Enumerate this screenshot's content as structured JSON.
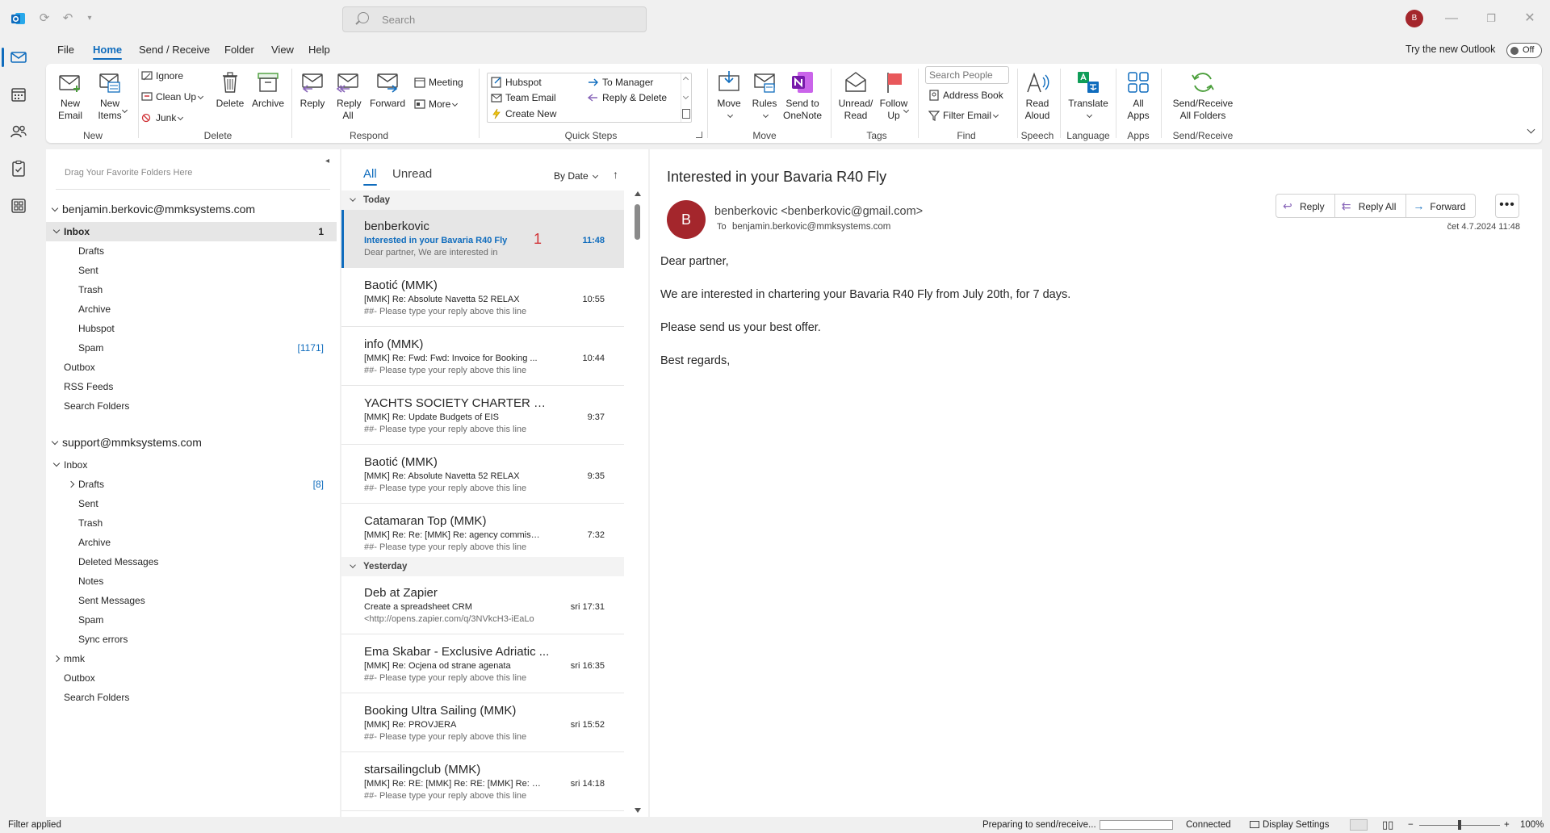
{
  "titlebar": {
    "search_placeholder": "Search",
    "avatar_initial": "B"
  },
  "menu": {
    "tabs": [
      "File",
      "Home",
      "Send / Receive",
      "Folder",
      "View",
      "Help"
    ],
    "active": "Home",
    "try_new": "Try the new Outlook",
    "toggle_state": "Off"
  },
  "ribbon": {
    "new_email": "New Email",
    "new_items": "New Items",
    "ignore": "Ignore",
    "clean_up": "Clean Up",
    "junk": "Junk",
    "delete": "Delete",
    "archive": "Archive",
    "reply": "Reply",
    "reply_all": "Reply All",
    "forward": "Forward",
    "meeting": "Meeting",
    "more": "More",
    "qs_hubspot": "Hubspot",
    "qs_team_email": "Team Email",
    "qs_create_new": "Create New",
    "qs_to_manager": "To Manager",
    "qs_reply_delete": "Reply & Delete",
    "move": "Move",
    "rules": "Rules",
    "send_onenote": "Send to OneNote",
    "unread_read": "Unread/ Read",
    "follow_up": "Follow Up",
    "search_people": "Search People",
    "address_book": "Address Book",
    "filter_email": "Filter Email",
    "read_aloud": "Read Aloud",
    "translate": "Translate",
    "all_apps": "All Apps",
    "send_receive_all": "Send/Receive All Folders",
    "groups": {
      "new": "New",
      "delete": "Delete",
      "respond": "Respond",
      "quick_steps": "Quick Steps",
      "move": "Move",
      "tags": "Tags",
      "find": "Find",
      "speech": "Speech",
      "language": "Language",
      "apps": "Apps",
      "send_receive": "Send/Receive"
    }
  },
  "folders": {
    "fav_hint": "Drag Your Favorite Folders Here",
    "account1": "benjamin.berkovic@mmksystems.com",
    "account1_folders": [
      {
        "name": "Inbox",
        "count": "1"
      },
      {
        "name": "Drafts",
        "count": ""
      },
      {
        "name": "Sent",
        "count": ""
      },
      {
        "name": "Trash",
        "count": ""
      },
      {
        "name": "Archive",
        "count": ""
      },
      {
        "name": "Hubspot",
        "count": ""
      },
      {
        "name": "Spam",
        "count": "[1171]"
      },
      {
        "name": "Outbox",
        "count": ""
      },
      {
        "name": "RSS Feeds",
        "count": ""
      },
      {
        "name": "Search Folders",
        "count": ""
      }
    ],
    "account2": "support@mmksystems.com",
    "account2_folders": [
      {
        "name": "Inbox",
        "count": ""
      },
      {
        "name": "Drafts",
        "count": "[8]"
      },
      {
        "name": "Sent",
        "count": ""
      },
      {
        "name": "Trash",
        "count": ""
      },
      {
        "name": "Archive",
        "count": ""
      },
      {
        "name": "Deleted Messages",
        "count": ""
      },
      {
        "name": "Notes",
        "count": ""
      },
      {
        "name": "Sent Messages",
        "count": ""
      },
      {
        "name": "Spam",
        "count": ""
      },
      {
        "name": "Sync errors",
        "count": ""
      },
      {
        "name": "mmk",
        "count": ""
      },
      {
        "name": "Outbox",
        "count": ""
      },
      {
        "name": "Search Folders",
        "count": ""
      }
    ]
  },
  "messages": {
    "tab_all": "All",
    "tab_unread": "Unread",
    "sort": "By Date",
    "group_today": "Today",
    "group_yesterday": "Yesterday",
    "today": [
      {
        "sender": "benberkovic",
        "subject": "Interested in your Bavaria R40 Fly",
        "preview": "Dear partner,  We are interested in",
        "time": "11:48",
        "badge": "1"
      },
      {
        "sender": "Baotić (MMK)",
        "subject": "[MMK] Re: Absolute Navetta 52 RELAX",
        "preview": "##- Please type your reply above this line",
        "time": "10:55"
      },
      {
        "sender": "info (MMK)",
        "subject": "[MMK] Re: Fwd: Fwd: Invoice for Booking ...",
        "preview": "##- Please type your reply above this line",
        "time": "10:44"
      },
      {
        "sender": "YACHTS SOCIETY CHARTER (M...",
        "subject": "[MMK] Re: Update Budgets of EIS",
        "preview": "##- Please type your reply above this line",
        "time": "9:37"
      },
      {
        "sender": "Baotić (MMK)",
        "subject": "[MMK] Re: Absolute Navetta 52 RELAX",
        "preview": "##- Please type your reply above this line",
        "time": "9:35"
      },
      {
        "sender": "Catamaran Top (MMK)",
        "subject": "[MMK] Re: Re: [MMK] Re: agency commissio...",
        "preview": "##- Please type your reply above this line",
        "time": "7:32"
      }
    ],
    "yesterday": [
      {
        "sender": "Deb at Zapier",
        "subject": "Create a spreadsheet CRM",
        "preview": "<http://opens.zapier.com/q/3NVkcH3-iEaLo",
        "time": "sri 17:31"
      },
      {
        "sender": "Ema Skabar - Exclusive Adriatic ...",
        "subject": "[MMK] Re: Ocjena od strane agenata",
        "preview": "##- Please type your reply above this line",
        "time": "sri 16:35"
      },
      {
        "sender": "Booking Ultra Sailing (MMK)",
        "subject": "[MMK] Re: PROVJERA",
        "preview": "##- Please type your reply above this line",
        "time": "sri 15:52"
      },
      {
        "sender": "starsailingclub (MMK)",
        "subject": "[MMK] Re: RE: [MMK] Re: RE: [MMK] Re: F...",
        "preview": "##- Please type your reply above this line",
        "time": "sri 14:18"
      }
    ]
  },
  "reading": {
    "subject": "Interested in your Bavaria R40 Fly",
    "avatar_initial": "B",
    "from": "benberkovic <benberkovic@gmail.com>",
    "to_label": "To",
    "to": "benjamin.berkovic@mmksystems.com",
    "date": "čet 4.7.2024 11:48",
    "reply": "Reply",
    "reply_all": "Reply All",
    "forward": "Forward",
    "body": [
      "Dear partner,",
      "We are interested in chartering your Bavaria R40 Fly from July 20th, for 7 days.",
      "Please send us your best offer.",
      "Best regards,"
    ]
  },
  "status": {
    "filter": "Filter applied",
    "preparing": "Preparing to send/receive...",
    "connected": "Connected",
    "display_settings": "Display Settings",
    "zoom": "100%"
  },
  "colors": {
    "accent": "#0f6cbd",
    "avatar": "#a4262c"
  }
}
